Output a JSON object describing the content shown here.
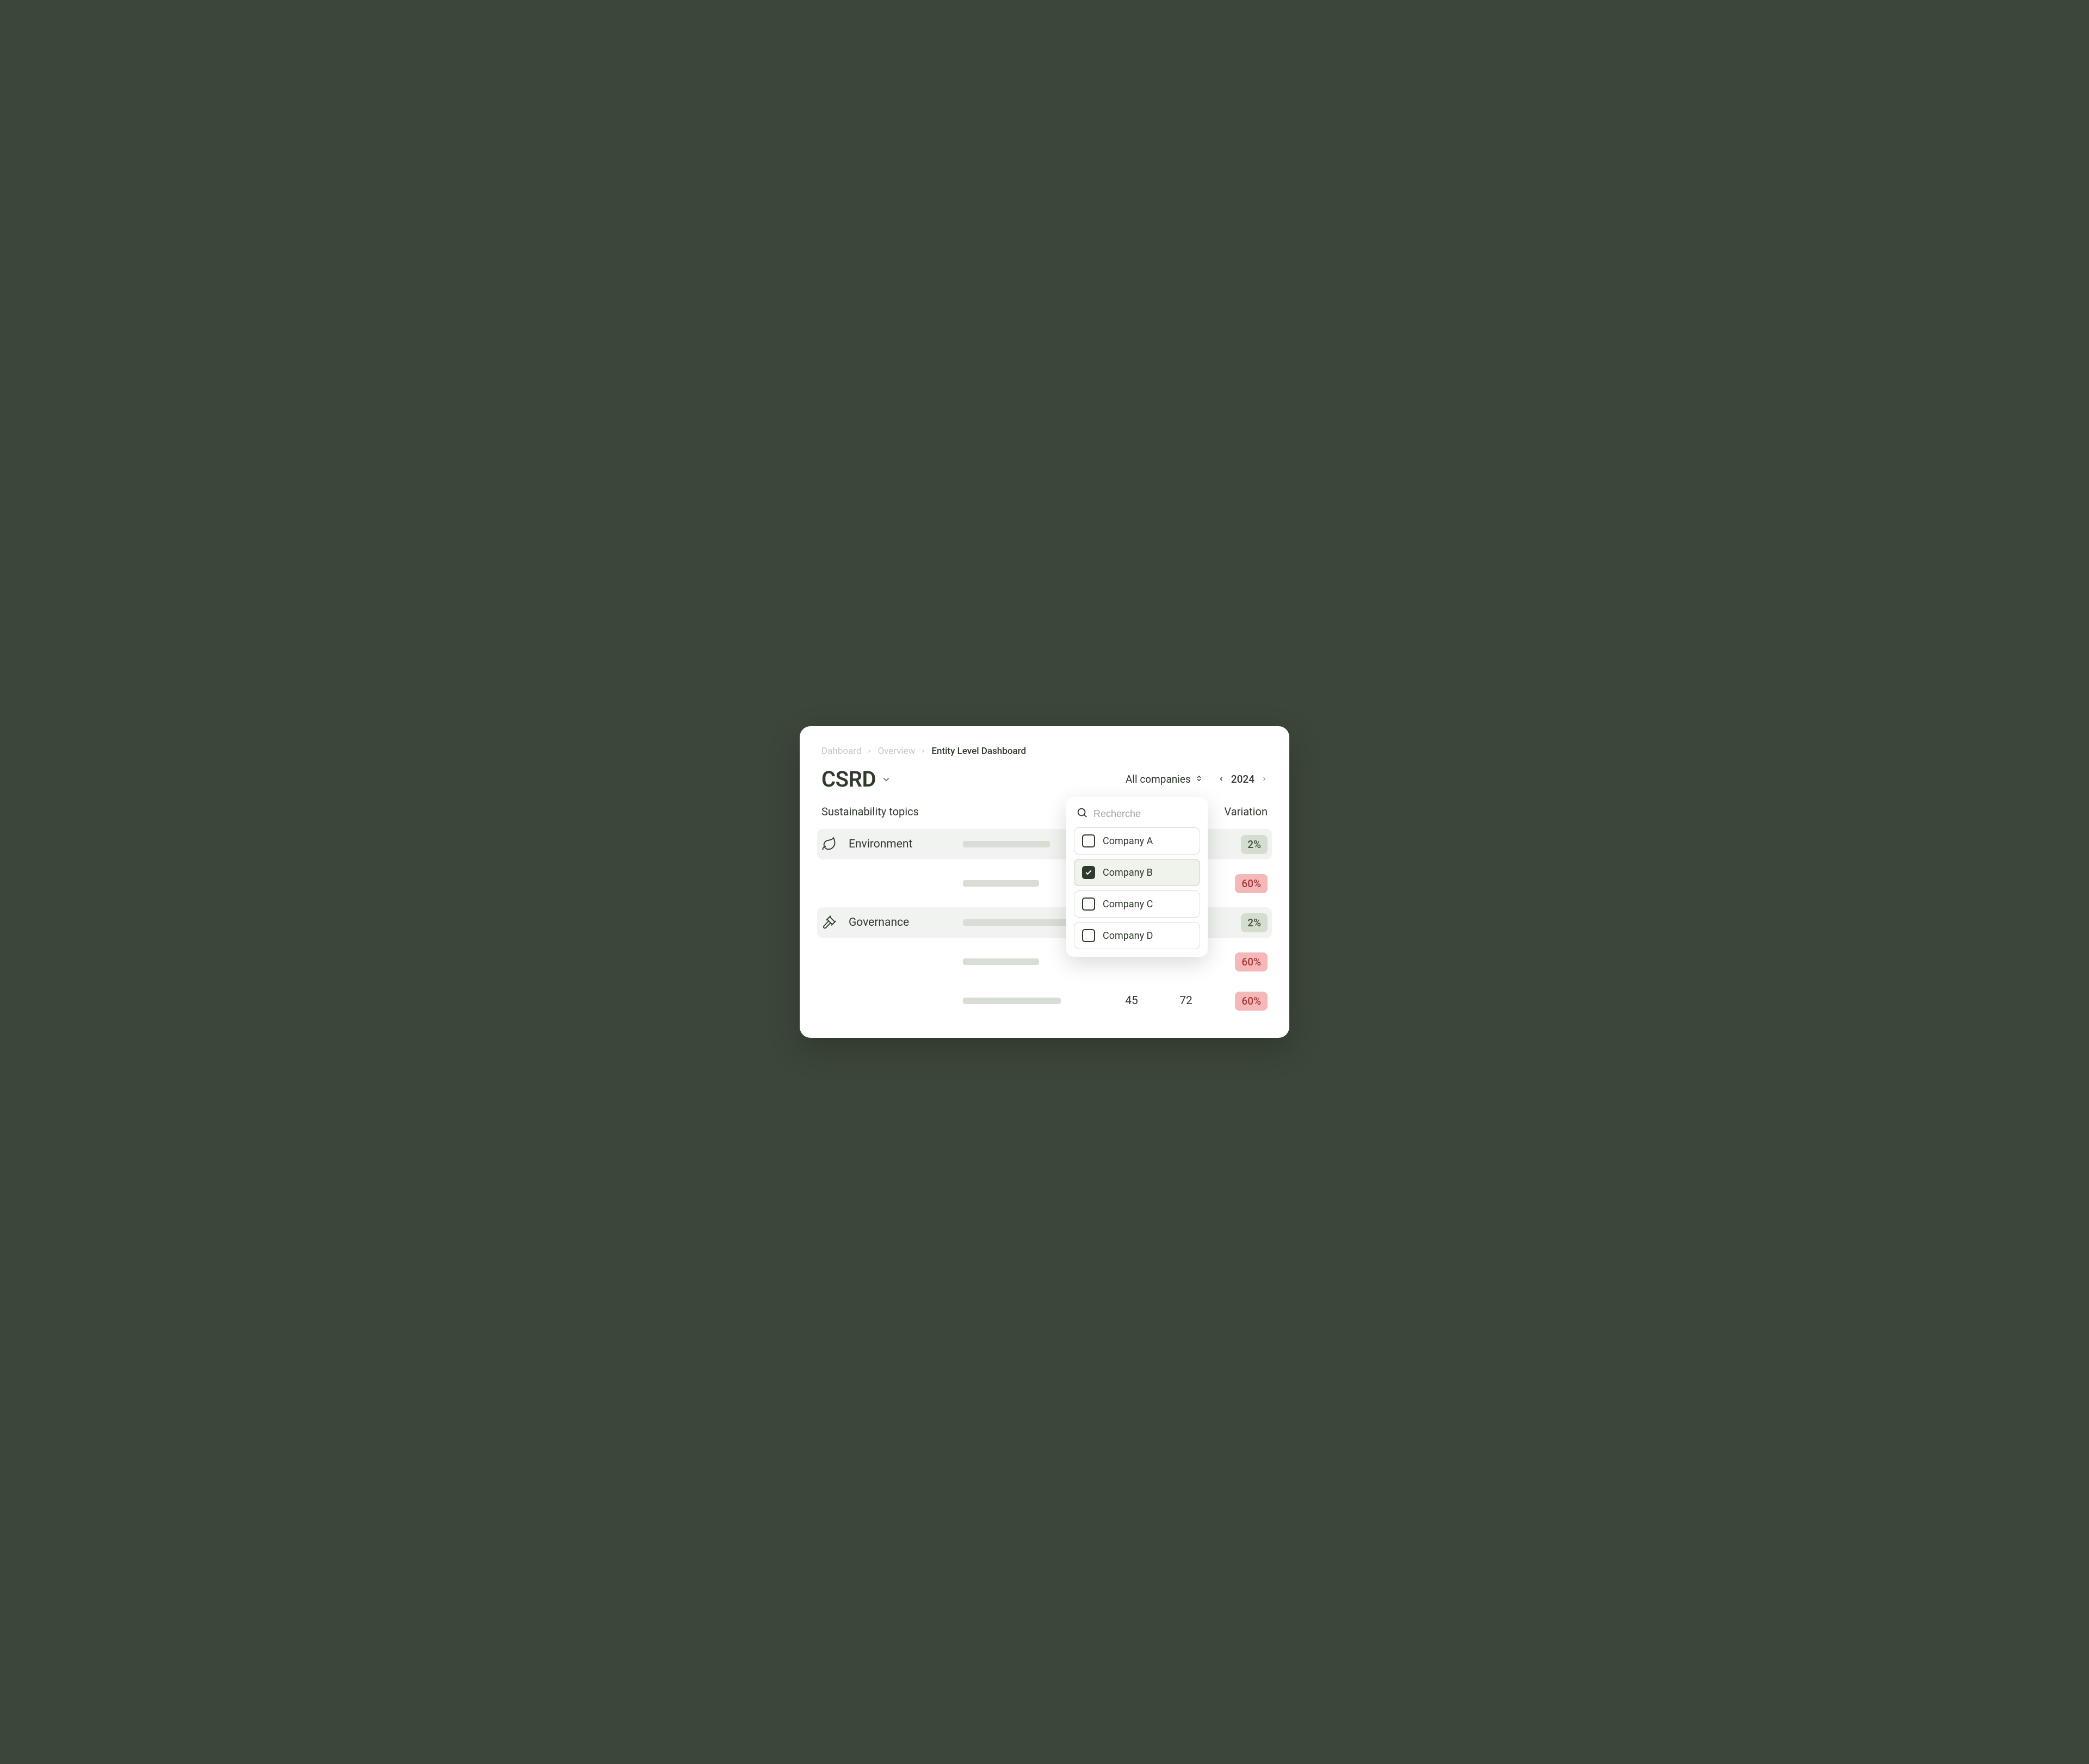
{
  "breadcrumb": {
    "item0": "Dahboard",
    "item1": "Overview",
    "item2": "Entity Level Dashboard"
  },
  "header": {
    "title": "CSRD",
    "filter_label": "All companies",
    "year": "2024"
  },
  "columns": {
    "topics": "Sustainability topics",
    "variation": "Variation"
  },
  "topics": {
    "environment": "Environment",
    "governance": "Governance"
  },
  "rows": {
    "r0": {
      "variation": "2%"
    },
    "r1": {
      "variation": "60%"
    },
    "r2": {
      "variation": "2%"
    },
    "r3": {
      "variation": "60%"
    },
    "r4": {
      "val1": "45",
      "val2": "72",
      "variation": "60%"
    }
  },
  "dropdown": {
    "search_placeholder": "Recherche",
    "optionA": "Company A",
    "optionB": "Company B",
    "optionC": "Company C",
    "optionD": "Company D"
  },
  "colors": {
    "badge_green_bg": "#d4ddd0",
    "badge_red_bg": "#f5b8b8"
  }
}
